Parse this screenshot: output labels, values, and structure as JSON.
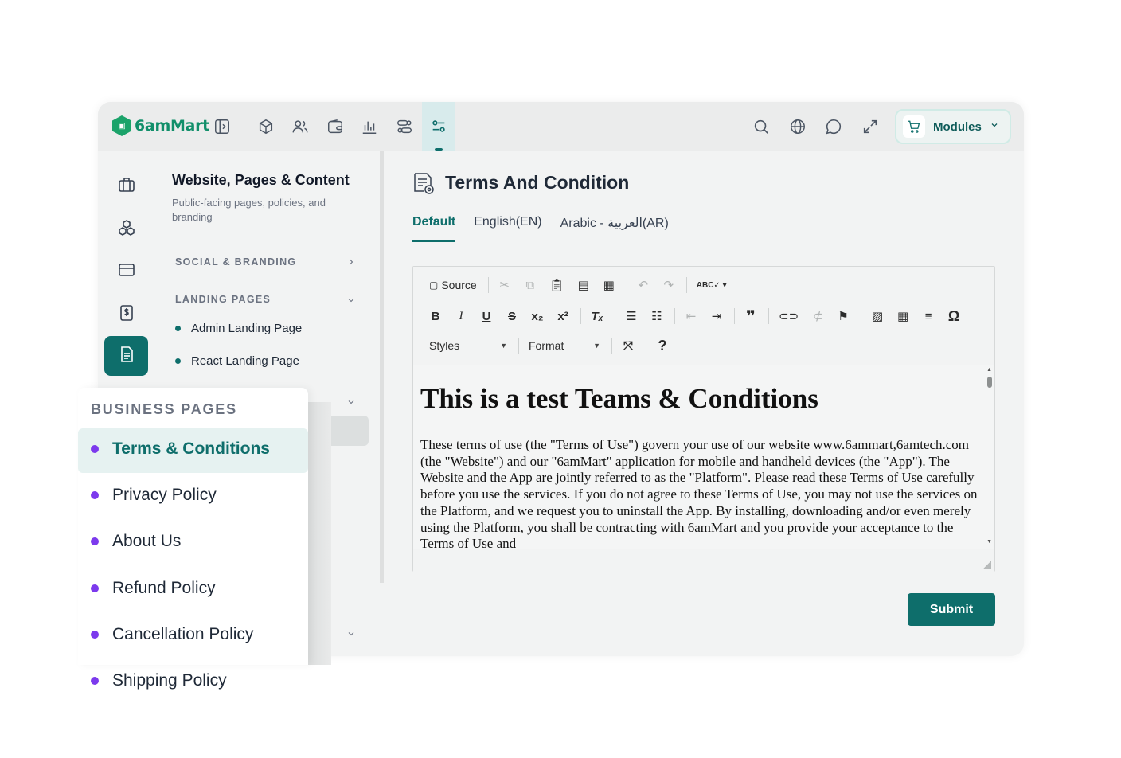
{
  "brand": {
    "name": "6amMart"
  },
  "header": {
    "icons": [
      "sidebar-toggle-icon",
      "box-icon",
      "users-icon",
      "wallet-icon",
      "chart-icon",
      "settings-icon",
      "filters-icon"
    ],
    "right_icons": [
      "search-icon",
      "globe-icon",
      "chat-icon",
      "expand-icon"
    ],
    "modules_label": "Modules"
  },
  "nav": {
    "title": "Website, Pages & Content",
    "subtitle": "Public-facing pages, policies, and branding",
    "groups": {
      "social": "SOCIAL & BRANDING",
      "landing": "LANDING PAGES",
      "landing_items": [
        "Admin Landing Page",
        "React Landing Page"
      ]
    }
  },
  "business_pages": {
    "title": "BUSINESS PAGES",
    "items": [
      "Terms & Conditions",
      "Privacy Policy",
      "About Us",
      "Refund Policy",
      "Cancellation Policy",
      "Shipping Policy"
    ],
    "active_index": 0
  },
  "content": {
    "title": "Terms And Condition",
    "tabs": [
      "Default",
      "English(EN)",
      "Arabic - العربية(AR)"
    ],
    "active_tab": 0
  },
  "editor": {
    "source_label": "Source",
    "styles_label": "Styles",
    "format_label": "Format",
    "heading": "This is a test Teams & Conditions",
    "body": "These terms of use (the \"Terms of Use\") govern your use of our website www.6ammart,6amtech.com (the \"Website\") and our \"6amMart\" application for mobile and handheld devices (the \"App\"). The Website and the App are jointly referred to as the \"Platform\". Please read these Terms of Use carefully before you use the services. If you do not agree to these Terms of Use, you may not use the services on the Platform, and we request you to uninstall the App. By installing, downloading and/or even merely using the Platform, you shall be contracting with 6amMart and you provide your acceptance to the Terms of Use and"
  },
  "submit_label": "Submit",
  "colors": {
    "primary": "#0e6e6b",
    "accent_dot": "#7c3aed",
    "brand_green": "#1ba36a"
  }
}
